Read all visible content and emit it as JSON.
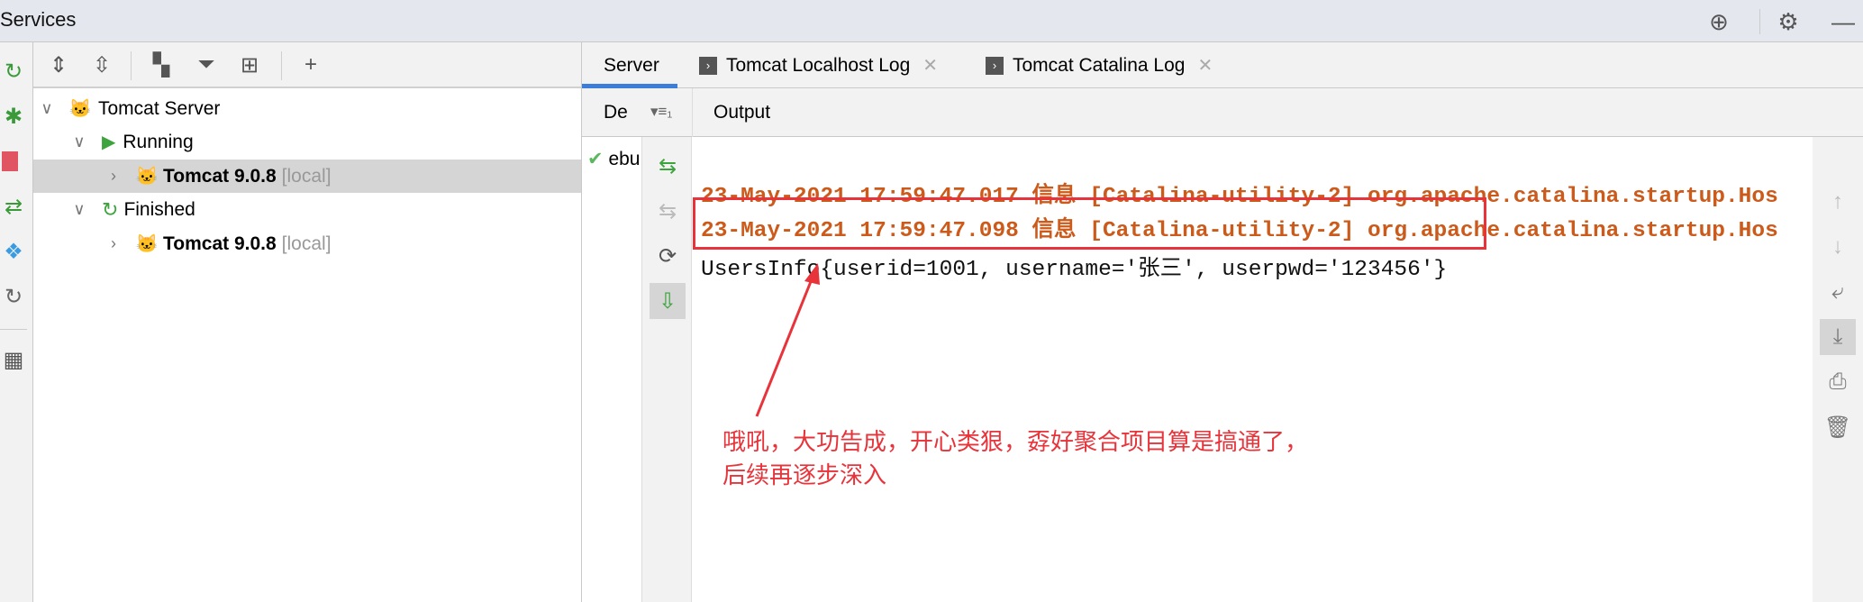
{
  "window": {
    "title": "Services",
    "icons": [
      "locate-icon",
      "gear-icon",
      "minimize-icon"
    ]
  },
  "left_strip": {
    "icons": [
      "rerun-icon",
      "debug-icon",
      "stop-icon",
      "deploy-icon",
      "services-icon",
      "refresh-icon",
      "layout-icon"
    ]
  },
  "tree_toolbar": {
    "icons": [
      "expand-all-icon",
      "collapse-all-icon",
      "group-icon",
      "filter-icon",
      "new-tab-icon",
      "add-icon"
    ]
  },
  "tree": [
    {
      "label": "Tomcat Server",
      "level": 0,
      "expanded": true
    },
    {
      "label": "Running",
      "level": 1,
      "expanded": true
    },
    {
      "label": "Tomcat 9.0.8",
      "suffix": "[local]",
      "level": 2,
      "selected": true
    },
    {
      "label": "Finished",
      "level": 1,
      "expanded": true
    },
    {
      "label": "Tomcat 9.0.8",
      "suffix": "[local]",
      "level": 2
    }
  ],
  "tabs": [
    {
      "label": "Server",
      "active": true
    },
    {
      "label": "Tomcat Localhost Log",
      "closable": true
    },
    {
      "label": "Tomcat Catalina Log",
      "closable": true
    }
  ],
  "header": {
    "deploy_col": "De",
    "sort_label": "▾≡₁",
    "output": "Output"
  },
  "deployment": {
    "item": "ebu"
  },
  "output": {
    "lines": [
      "23-May-2021 17:59:47.017 信息 [Catalina-utility-2] org.apache.catalina.startup.Hos",
      "23-May-2021 17:59:47.098 信息 [Catalina-utility-2] org.apache.catalina.startup.Hos",
      "UsersInfo{userid=1001, username='张三', userpwd='123456'}"
    ],
    "log_color": "#cc5a1a"
  },
  "annotation": {
    "line1": "哦吼，大功告成，开心类狠，孬好聚合项目算是搞通了，",
    "line2": "后续再逐步深入",
    "color": "#e8333a"
  }
}
